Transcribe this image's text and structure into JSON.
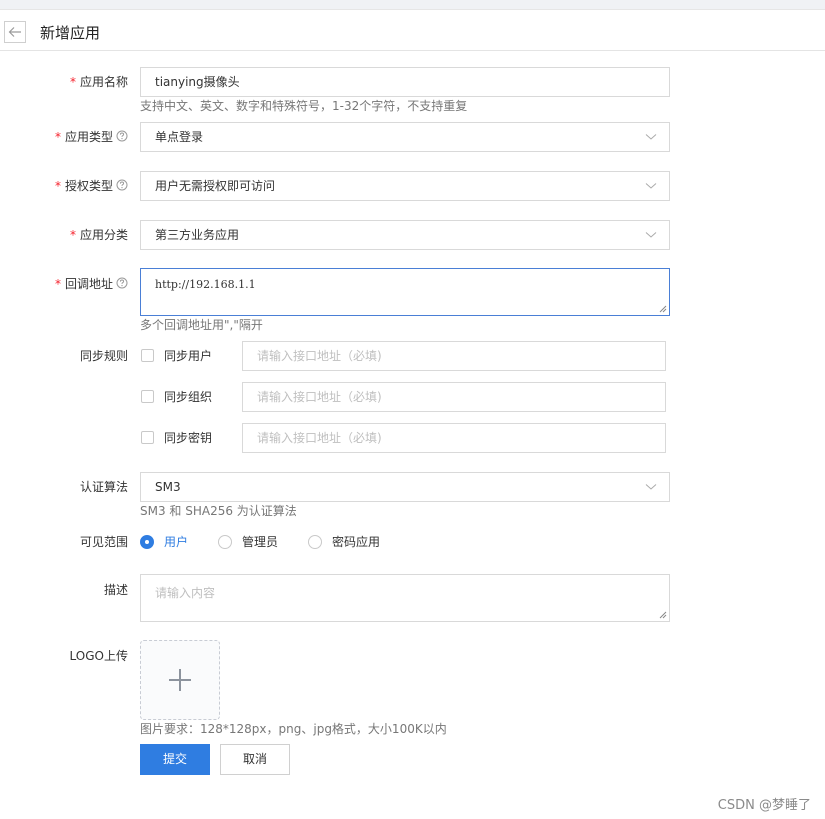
{
  "header": {
    "title": "新增应用"
  },
  "form": {
    "app_name": {
      "label": "应用名称",
      "value": "tianying摄像头",
      "hint": "支持中文、英文、数字和特殊符号，1-32个字符，不支持重复"
    },
    "app_type": {
      "label": "应用类型",
      "value": "单点登录"
    },
    "auth_type": {
      "label": "授权类型",
      "value": "用户无需授权即可访问"
    },
    "app_category": {
      "label": "应用分类",
      "value": "第三方业务应用"
    },
    "callback": {
      "label": "回调地址",
      "value": "http://192.168.1.1",
      "hint": "多个回调地址用\",\"隔开"
    },
    "sync": {
      "label": "同步规则",
      "items": [
        {
          "label": "同步用户",
          "placeholder": "请输入接口地址（必填)"
        },
        {
          "label": "同步组织",
          "placeholder": "请输入接口地址（必填)"
        },
        {
          "label": "同步密钥",
          "placeholder": "请输入接口地址（必填)"
        }
      ]
    },
    "algorithm": {
      "label": "认证算法",
      "value": "SM3",
      "hint": "SM3 和 SHA256 为认证算法"
    },
    "scope": {
      "label": "可见范围",
      "options": [
        "用户",
        "管理员",
        "密码应用"
      ],
      "selected": "用户"
    },
    "description": {
      "label": "描述",
      "placeholder": "请输入内容"
    },
    "logo": {
      "label": "LOGO上传",
      "hint": "图片要求：128*128px，png、jpg格式，大小100K以内"
    }
  },
  "actions": {
    "submit": "提交",
    "cancel": "取消"
  },
  "watermark": "CSDN @梦睡了",
  "colors": {
    "primary": "#2f7de1",
    "required": "#f5222d",
    "focus_border": "#4a7fd6"
  }
}
